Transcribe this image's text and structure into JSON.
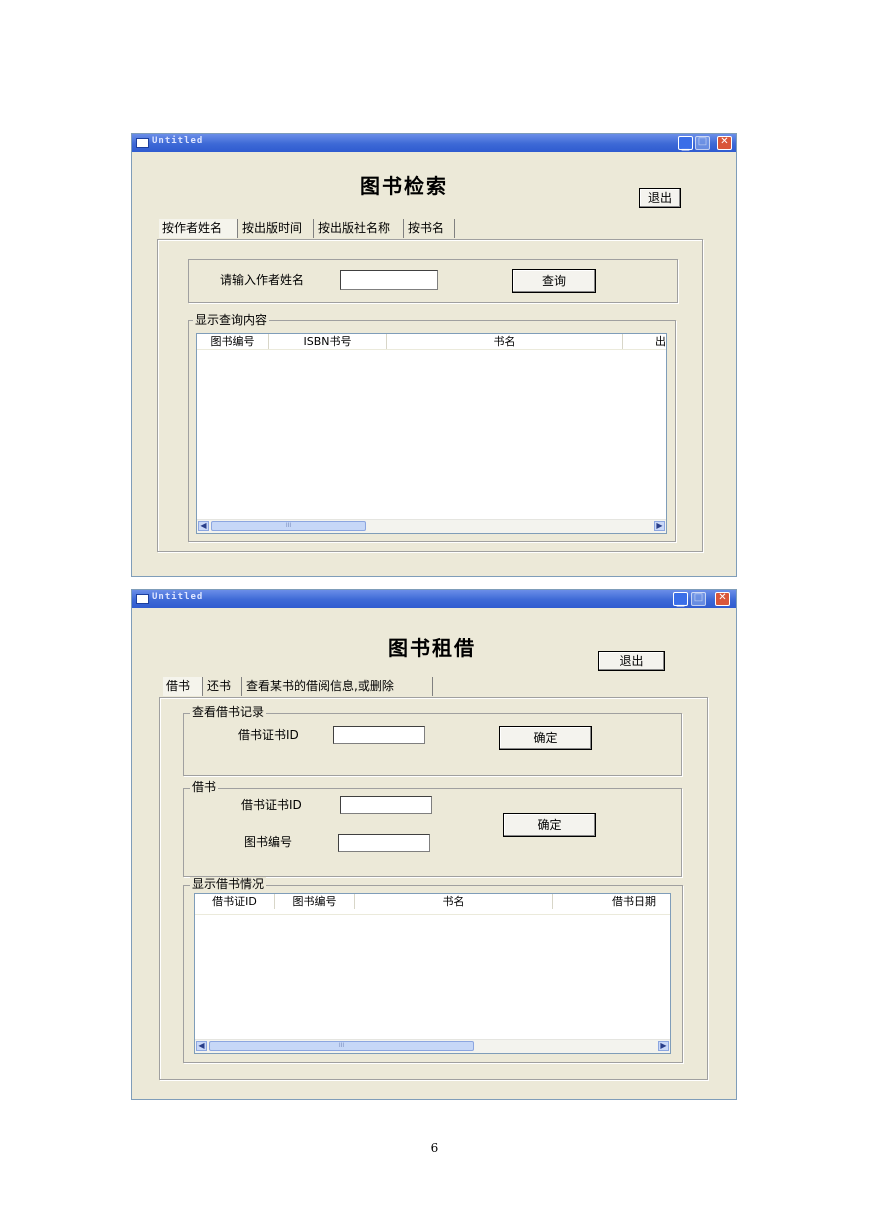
{
  "window1": {
    "title_bar": "Untitled",
    "heading": "图书检索",
    "exit_label": "退出",
    "tabs": [
      "按作者姓名",
      "按出版时间",
      "按出版社名称",
      "按书名"
    ],
    "author_prompt": "请输入作者姓名",
    "author_input_value": "",
    "query_label": "查询",
    "results_group": "显示查询内容",
    "columns": [
      "图书编号",
      "ISBN书号",
      "书名",
      "出"
    ],
    "scroll_thumb": "III"
  },
  "window2": {
    "title_bar": "Untitled",
    "heading": "图书租借",
    "exit_label": "退出",
    "tabs": [
      "借书",
      "还书",
      "查看某书的借阅信息,或删除"
    ],
    "view_group": "查看借书记录",
    "view_card_label": "借书证书ID",
    "view_card_value": "",
    "view_confirm": "确定",
    "borrow_group": "借书",
    "borrow_card_label": "借书证书ID",
    "borrow_card_value": "",
    "borrow_book_label": "图书编号",
    "borrow_book_value": "",
    "borrow_confirm": "确定",
    "list_group": "显示借书情况",
    "columns": [
      "借书证ID",
      "图书编号",
      "书名",
      "借书日期"
    ],
    "scroll_thumb": "III"
  },
  "page_number": "6"
}
